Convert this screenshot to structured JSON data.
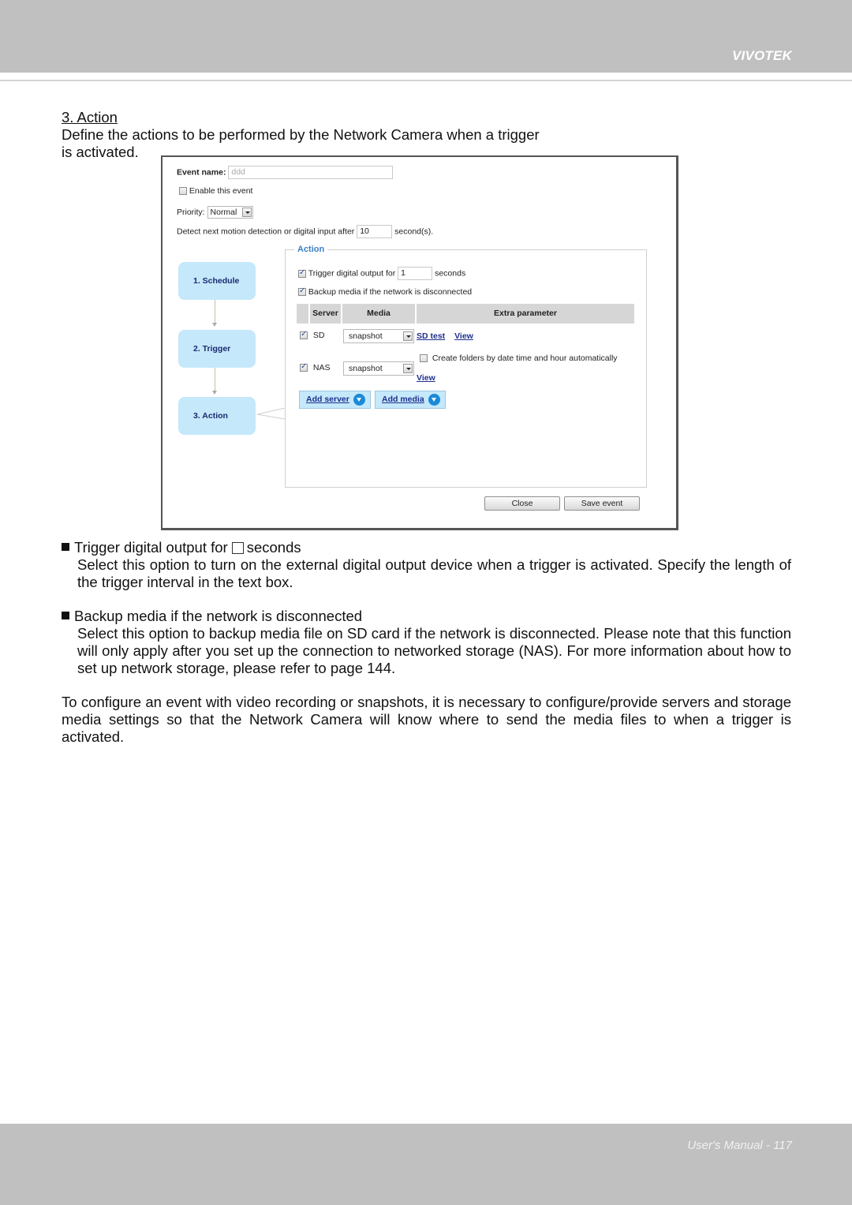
{
  "header": {
    "brand": "VIVOTEK"
  },
  "footer": {
    "page_label": "User's Manual - 117"
  },
  "section": {
    "title": "3. Action",
    "intro_line1": "Define the actions to be performed by the Network Camera when a trigger",
    "intro_line2": "is activated."
  },
  "screenshot": {
    "event_name_label": "Event name:",
    "event_name_value": "ddd",
    "enable_event_label": "Enable this event",
    "enable_event_checked": false,
    "priority_label": "Priority:",
    "priority_value": "Normal",
    "detect_label": "Detect next motion detection or digital input after",
    "detect_value": "10",
    "detect_unit": "second(s).",
    "steps": [
      {
        "label": "1.  Schedule"
      },
      {
        "label": "2.  Trigger"
      },
      {
        "label": "3.  Action"
      }
    ],
    "action_legend": "Action",
    "trigger_output_label": "Trigger digital output for",
    "trigger_output_value": "1",
    "trigger_output_unit": "seconds",
    "trigger_output_checked": true,
    "backup_label": "Backup media if the network is disconnected",
    "backup_checked": true,
    "table": {
      "headers": [
        "Server",
        "Media",
        "Extra parameter"
      ],
      "rows": [
        {
          "server": "SD",
          "checked": true,
          "media": "snapshot",
          "links": [
            "SD test",
            "View"
          ]
        },
        {
          "server": "NAS",
          "checked": true,
          "media": "snapshot",
          "option_label": "Create folders by date time and hour automatically",
          "option_checked": false,
          "links": [
            "View"
          ]
        }
      ]
    },
    "add_server_label": "Add server",
    "add_media_label": "Add media",
    "close_label": "Close",
    "save_label": "Save event"
  },
  "bullets": [
    {
      "title_before": "Trigger digital output for",
      "title_after": "seconds",
      "body": "Select this option to turn on the external digital output device when a trigger is activated. Specify the length of the trigger interval in the text box."
    },
    {
      "title": "Backup media if the network is disconnected",
      "body": "Select this option to backup media file on SD card if the network is disconnected. Please note that this function will only apply after you set up the connection to networked storage (NAS). For more information about how to set up network storage, please refer to page 144."
    }
  ],
  "closing_paragraph": "To configure an event with video recording or snapshots, it is necessary to configure/provide servers and storage media settings so that the Network Camera will know where to send the media files to when a trigger is activated."
}
